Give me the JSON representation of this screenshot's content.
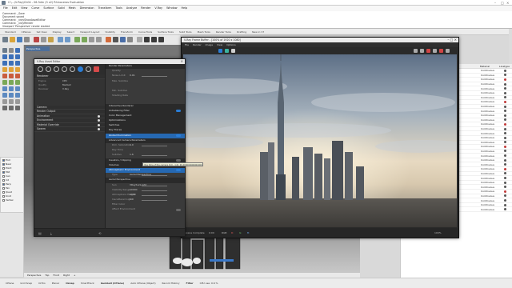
{
  "titlebar": {
    "title": "C:\\...\\V-Ray\\Ch04 - 06.3dm (3 x2) Rhinoceros Evaluation"
  },
  "menubar": [
    "File",
    "Edit",
    "View",
    "Curve",
    "Surface",
    "Solid",
    "Mesh",
    "Dimension",
    "Transform",
    "Tools",
    "Analyze",
    "Render",
    "V-Ray",
    "Window",
    "Help"
  ],
  "command_history": [
    "Command: _Save",
    "Document saved",
    "Command: _vrayShowAssetEditor",
    "Command: _vrayRender",
    "Viewport 'Perspective' render started"
  ],
  "toolbar_tabs": [
    "Standard",
    "CPlanes",
    "Set View",
    "Display",
    "Select",
    "Viewport Layout",
    "Visibility",
    "Transform",
    "Curve Tools",
    "Surface Tools",
    "Solid Tools",
    "Mesh Tools",
    "Render Tools",
    "Drafting",
    "New in V7"
  ],
  "viewport": {
    "label": "Perspective"
  },
  "osnap": {
    "items": [
      "End",
      "Near",
      "Point",
      "Mid",
      "Cen",
      "Int",
      "Perp",
      "Tan",
      "Quad",
      "Knot",
      "Vertex"
    ],
    "checked": [
      true,
      true,
      false,
      true,
      false,
      false,
      true,
      false,
      false,
      false,
      false
    ]
  },
  "viewport_tabs": [
    "Perspective",
    "Top",
    "Front",
    "Right"
  ],
  "layers": {
    "headers": [
      "Name",
      "Material",
      "Linetype"
    ],
    "rows": [
      {
        "name": "",
        "material": "Continuous"
      },
      {
        "name": "",
        "material": "Continuous"
      },
      {
        "name": "",
        "material": "Continuous"
      },
      {
        "name": "",
        "material": "Continuous"
      },
      {
        "name": "",
        "material": "Continuous"
      },
      {
        "name": "",
        "material": "Continuous"
      },
      {
        "name": "",
        "material": "Continuous"
      },
      {
        "name": "",
        "material": "Continuous"
      },
      {
        "name": "",
        "material": "Continuous"
      },
      {
        "name": "",
        "material": "Continuous"
      },
      {
        "name": "",
        "material": "Continuous"
      },
      {
        "name": "",
        "material": "Continuous"
      },
      {
        "name": "",
        "material": "Continuous"
      },
      {
        "name": "",
        "material": "Continuous"
      },
      {
        "name": "",
        "material": "Continuous"
      },
      {
        "name": "",
        "material": "Continuous"
      },
      {
        "name": "",
        "material": "Continuous"
      },
      {
        "name": "",
        "material": "Continuous"
      },
      {
        "name": "",
        "material": "Continuous"
      },
      {
        "name": "",
        "material": "Continuous"
      },
      {
        "name": "",
        "material": "Continuous"
      },
      {
        "name": "",
        "material": "Continuous"
      },
      {
        "name": "",
        "material": "Continuous"
      },
      {
        "name": "",
        "material": "Continuous"
      },
      {
        "name": "",
        "material": "Continuous"
      },
      {
        "name": "",
        "material": "Continuous"
      },
      {
        "name": "",
        "material": "Continuous"
      },
      {
        "name": "",
        "material": "Continuous"
      },
      {
        "name": "",
        "material": "Continuous"
      },
      {
        "name": "",
        "material": "Continuous"
      },
      {
        "name": "",
        "material": "Continuous"
      },
      {
        "name": "",
        "material": "Continuous"
      }
    ]
  },
  "statusbar": [
    "CPlane",
    "Grid Snap",
    "Ortho",
    "Planar",
    "Osnap",
    "SmartTrack",
    "Gumball (CPlane)",
    "Auto CPlane (Object)",
    "Record History",
    "Filter",
    "CPU use: 0.6 %"
  ],
  "asset_editor": {
    "title": "V-Ray Asset Editor",
    "left_sections": [
      "Renderer",
      "Camera",
      "Render Output",
      "Animation",
      "Environment",
      "Material Override",
      "Swarm"
    ],
    "props": [
      {
        "label": "Engine",
        "value": "CPU"
      },
      {
        "label": "Quality",
        "value": "Medium"
      },
      {
        "label": "Denoiser",
        "value": "V-Ray"
      }
    ],
    "right_rows": [
      {
        "text": "Render Parameters",
        "kind": "hd"
      },
      {
        "text": "Quality",
        "kind": "sub"
      },
      {
        "text": "Noise Limit",
        "kind": "sub",
        "num": "0.01"
      },
      {
        "text": "Max. Subdivs",
        "kind": "sub"
      },
      {
        "text": "",
        "kind": "sub"
      },
      {
        "text": "Min. Subdivs",
        "kind": "sub"
      },
      {
        "text": "Shading Rate",
        "kind": "sub"
      },
      {
        "text": "",
        "kind": "sub"
      },
      {
        "text": "Interactive Renderer",
        "kind": "hd"
      },
      {
        "text": "Antialiasing Filter",
        "kind": "hd",
        "toggle": "on"
      },
      {
        "text": "Color Management",
        "kind": "hd"
      },
      {
        "text": "Optimizations",
        "kind": "hd"
      },
      {
        "text": "Switches",
        "kind": "hd"
      },
      {
        "text": "Ray Traces",
        "kind": "hd"
      },
      {
        "text": "Global Illumination",
        "kind": "blue",
        "toggle": "on"
      },
      {
        "text": "Advanced Camera Parameters",
        "kind": "hd"
      },
      {
        "text": "Dim. Saturation",
        "kind": "sub",
        "num": "1.0"
      },
      {
        "text": "Ray Time",
        "kind": "sub"
      },
      {
        "text": "Subdivs",
        "kind": "sub",
        "num": "1.6"
      },
      {
        "text": "Caustics / Clipping",
        "kind": "hd",
        "toggle": "off"
      },
      {
        "text": "Volumes",
        "kind": "hd"
      },
      {
        "text": "Atmospheric Environment",
        "kind": "blue",
        "toggle": "on"
      },
      {
        "text": "Type",
        "kind": "sub",
        "num": "Aerial Perspective"
      },
      {
        "text": "Aerial Perspective",
        "kind": "hd"
      },
      {
        "text": "Sun",
        "kind": "sub",
        "num": "VRaySunLight"
      },
      {
        "text": "Visibility Range",
        "kind": "sub",
        "num": "10000"
      },
      {
        "text": "Atmosphere Height",
        "kind": "sub",
        "num": "1000"
      },
      {
        "text": "Inscattered Light",
        "kind": "sub",
        "num": "1.0"
      },
      {
        "text": "Filter Color",
        "kind": "sub"
      },
      {
        "text": "Affect Environment",
        "kind": "sub",
        "toggle": "off"
      }
    ],
    "tooltip": "Ray time of the camera (0.0 - 1.0): 99.000000000000000"
  },
  "vfb": {
    "title": "V-Ray Frame Buffer - [100% of 1920 x 1080]",
    "menu": [
      "File",
      "Render",
      "Image",
      "View",
      "Options"
    ],
    "status": [
      "Scene Complete",
      "0:00",
      "RGB",
      "R:",
      "G:",
      "B:",
      "100%"
    ]
  },
  "colors": {
    "accent": "#2a7dd6",
    "panel_bg": "#3a3a3a",
    "vfb_bg": "#2a2a2a"
  }
}
